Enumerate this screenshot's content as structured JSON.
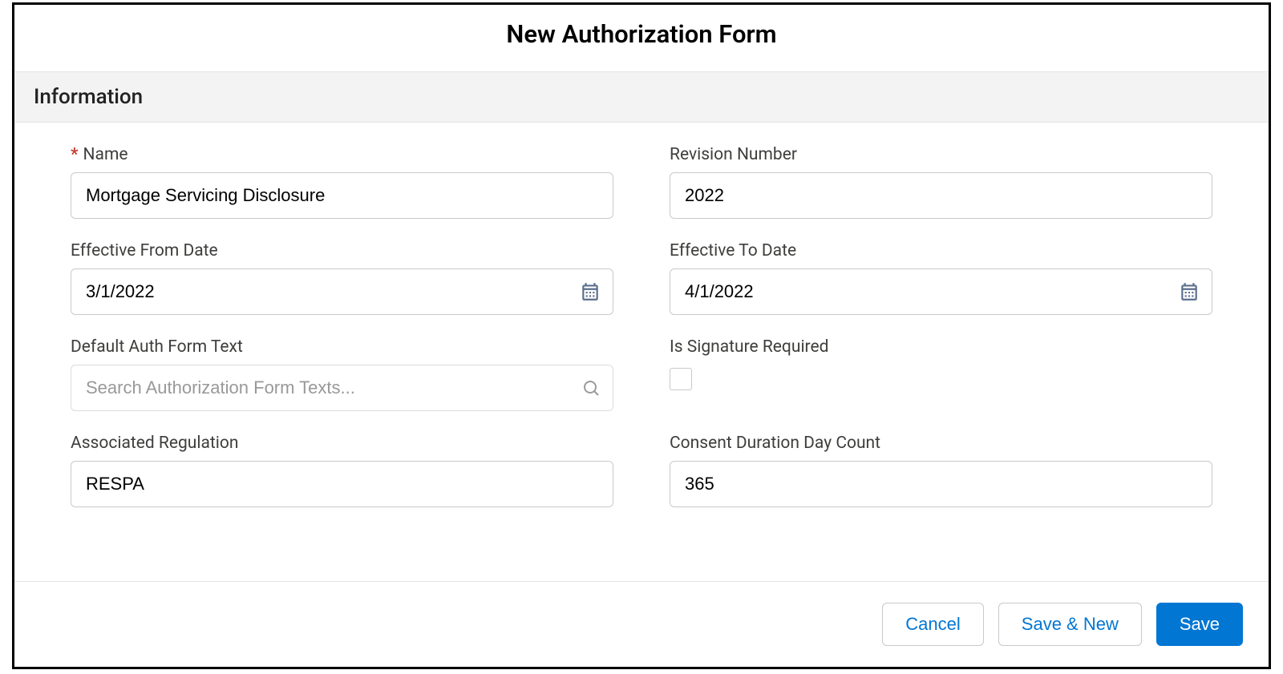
{
  "modal": {
    "title": "New Authorization Form"
  },
  "section": {
    "information_header": "Information"
  },
  "fields": {
    "name": {
      "label": "Name",
      "required": true,
      "value": "Mortgage Servicing Disclosure"
    },
    "revision_number": {
      "label": "Revision Number",
      "value": "2022"
    },
    "effective_from_date": {
      "label": "Effective From Date",
      "value": "3/1/2022"
    },
    "effective_to_date": {
      "label": "Effective To Date",
      "value": "4/1/2022"
    },
    "default_auth_form_text": {
      "label": "Default Auth Form Text",
      "placeholder": "Search Authorization Form Texts..."
    },
    "is_signature_required": {
      "label": "Is Signature Required",
      "checked": false
    },
    "associated_regulation": {
      "label": "Associated Regulation",
      "value": "RESPA"
    },
    "consent_duration_day_count": {
      "label": "Consent Duration Day Count",
      "value": "365"
    }
  },
  "footer": {
    "cancel": "Cancel",
    "save_new": "Save & New",
    "save": "Save"
  }
}
